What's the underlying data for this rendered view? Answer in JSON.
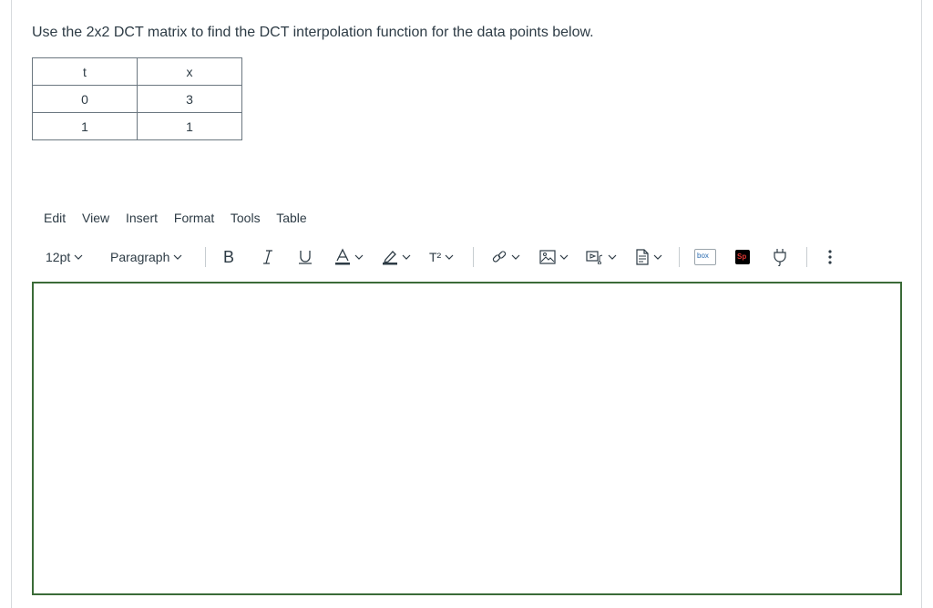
{
  "question": {
    "text": "Use the 2x2 DCT matrix to find the DCT interpolation function for the data points below."
  },
  "table": {
    "headers": [
      "t",
      "x"
    ],
    "rows": [
      [
        "0",
        "3"
      ],
      [
        "1",
        "1"
      ]
    ]
  },
  "menubar": {
    "items": [
      "Edit",
      "View",
      "Insert",
      "Format",
      "Tools",
      "Table"
    ]
  },
  "toolbar": {
    "font_size": "12pt",
    "block_format": "Paragraph",
    "superscript_label": "T²",
    "icons": [
      "bold-icon",
      "italic-icon",
      "underline-icon",
      "text-color-icon",
      "highlight-icon",
      "superscript-icon",
      "link-icon",
      "image-icon",
      "media-icon",
      "document-icon",
      "box-icon",
      "sp-app-icon",
      "plugin-icon",
      "more-icon"
    ],
    "box_label": "box",
    "sp_label": "Sp"
  },
  "colors": {
    "text": "#2d3b45",
    "editor_border": "#3b6b38",
    "sp_red": "#c8102e"
  }
}
